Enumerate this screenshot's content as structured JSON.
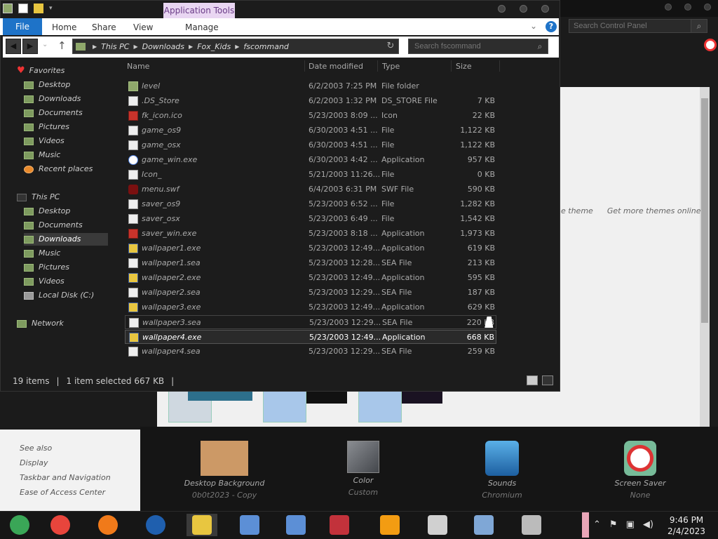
{
  "control_panel": {
    "search_placeholder": "Search Control Panel",
    "theme_link_partial": "e theme",
    "get_more_themes": "Get more themes online",
    "see_also": "See also",
    "side_links": [
      "Display",
      "Taskbar and Navigation",
      "Ease of Access Center"
    ],
    "bottom": [
      {
        "title": "Desktop Background",
        "sub": "0b0t2023 - Copy"
      },
      {
        "title": "Color",
        "sub": "Custom"
      },
      {
        "title": "Sounds",
        "sub": "Chromium"
      },
      {
        "title": "Screen Saver",
        "sub": "None"
      }
    ]
  },
  "explorer": {
    "app_tools": "Application Tools",
    "tabs": {
      "file": "File",
      "home": "Home",
      "share": "Share",
      "view": "View",
      "manage": "Manage"
    },
    "address": [
      "This PC",
      "Downloads",
      "Fox_Kids",
      "fscommand"
    ],
    "search_placeholder": "Search fscommand",
    "nav": {
      "favorites": "Favorites",
      "fav_items": [
        "Desktop",
        "Downloads",
        "Documents",
        "Pictures",
        "Videos",
        "Music",
        "Recent places"
      ],
      "this_pc": "This PC",
      "pc_items": [
        "Desktop",
        "Documents",
        "Downloads",
        "Music",
        "Pictures",
        "Videos",
        "Local Disk (C:)"
      ],
      "network": "Network"
    },
    "columns": {
      "name": "Name",
      "date": "Date modified",
      "type": "Type",
      "size": "Size"
    },
    "files": [
      {
        "name": "level",
        "date": "6/2/2003 7:25 PM",
        "type": "File folder",
        "size": "",
        "icon": "folder-icon"
      },
      {
        "name": ".DS_Store",
        "date": "6/2/2003 1:32 PM",
        "type": "DS_STORE File",
        "size": "7 KB",
        "icon": "file-icon"
      },
      {
        "name": "fk_icon.ico",
        "date": "5/23/2003 8:09 ...",
        "type": "Icon",
        "size": "22 KB",
        "icon": "ico-icon"
      },
      {
        "name": "game_os9",
        "date": "6/30/2003 4:51 ...",
        "type": "File",
        "size": "1,122 KB",
        "icon": "file-icon"
      },
      {
        "name": "game_osx",
        "date": "6/30/2003 4:51 ...",
        "type": "File",
        "size": "1,122 KB",
        "icon": "file-icon"
      },
      {
        "name": "game_win.exe",
        "date": "6/30/2003 4:42 ...",
        "type": "Application",
        "size": "957 KB",
        "icon": "shockwave-icon"
      },
      {
        "name": "Icon_",
        "date": "5/21/2003 11:26...",
        "type": "File",
        "size": "0 KB",
        "icon": "file-icon"
      },
      {
        "name": "menu.swf",
        "date": "6/4/2003 6:31 PM",
        "type": "SWF File",
        "size": "590 KB",
        "icon": "flash-icon"
      },
      {
        "name": "saver_os9",
        "date": "5/23/2003 6:52 ...",
        "type": "File",
        "size": "1,282 KB",
        "icon": "file-icon"
      },
      {
        "name": "saver_osx",
        "date": "5/23/2003 6:49 ...",
        "type": "File",
        "size": "1,542 KB",
        "icon": "file-icon"
      },
      {
        "name": "saver_win.exe",
        "date": "5/23/2003 8:18 ...",
        "type": "Application",
        "size": "1,973 KB",
        "icon": "ico-icon"
      },
      {
        "name": "wallpaper1.exe",
        "date": "5/23/2003 12:49...",
        "type": "Application",
        "size": "619 KB",
        "icon": "exe-icon"
      },
      {
        "name": "wallpaper1.sea",
        "date": "5/23/2003 12:28...",
        "type": "SEA File",
        "size": "213 KB",
        "icon": "file-icon"
      },
      {
        "name": "wallpaper2.exe",
        "date": "5/23/2003 12:49...",
        "type": "Application",
        "size": "595 KB",
        "icon": "exe-icon"
      },
      {
        "name": "wallpaper2.sea",
        "date": "5/23/2003 12:29...",
        "type": "SEA File",
        "size": "187 KB",
        "icon": "file-icon"
      },
      {
        "name": "wallpaper3.exe",
        "date": "5/23/2003 12:49...",
        "type": "Application",
        "size": "629 KB",
        "icon": "exe-icon"
      },
      {
        "name": "wallpaper3.sea",
        "date": "5/23/2003 12:29...",
        "type": "SEA File",
        "size": "220 KB",
        "icon": "file-icon"
      },
      {
        "name": "wallpaper4.exe",
        "date": "5/23/2003 12:49...",
        "type": "Application",
        "size": "668 KB",
        "icon": "exe-icon"
      },
      {
        "name": "wallpaper4.sea",
        "date": "5/23/2003 12:29...",
        "type": "SEA File",
        "size": "259 KB",
        "icon": "file-icon"
      }
    ],
    "selected_index": 17,
    "hover_index": 16,
    "status": {
      "count": "19 items",
      "selection": "1 item selected  667 KB"
    }
  },
  "taskbar": {
    "time": "9:46 PM",
    "date": "2/4/2023",
    "apps": [
      "chrome-alt-icon",
      "chrome-icon",
      "firefox-icon",
      "obama-logo-icon",
      "file-explorer-icon",
      "network-app-icon",
      "network-app-2-icon",
      "winrar-icon",
      "vlc-icon",
      "task-manager-icon",
      "photo-viewer-icon",
      "control-panel-icon"
    ]
  },
  "colors": {
    "accent": "#1e73c8",
    "app_tools_bg": "#e9d6f2",
    "folder": "#8fa86b"
  }
}
